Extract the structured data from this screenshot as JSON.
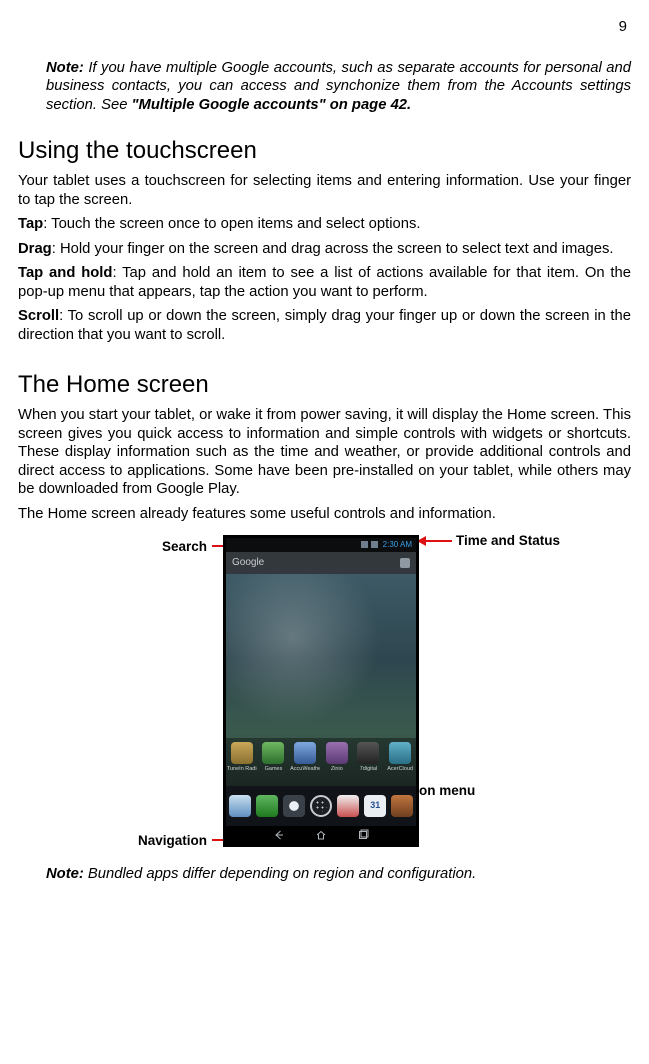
{
  "page_number": "9",
  "top_note": {
    "label": "Note:",
    "text_a": " If you have multiple Google accounts, such as separate accounts for personal and business contacts, you can access and synchonize them from the Accounts settings section. See ",
    "emph": "\"Multiple Google accounts\" on page 42.",
    "text_b": ""
  },
  "section1": {
    "heading": "Using the touchscreen",
    "intro": "Your tablet uses a touchscreen for selecting items and entering information. Use your finger to tap the screen.",
    "defs": [
      {
        "term": "Tap",
        "text": ": Touch the screen once to open items and select options."
      },
      {
        "term": "Drag",
        "text": ": Hold your finger on the screen and drag across the screen to select text and images."
      },
      {
        "term": "Tap and hold",
        "text": ": Tap and hold an item to see a list of actions available for that item. On the pop-up menu that appears, tap the action you want to perform."
      },
      {
        "term": "Scroll",
        "text": ": To scroll up or down the screen, simply drag your finger up or down the screen in the direction that you want to scroll."
      }
    ]
  },
  "section2": {
    "heading": "The Home screen",
    "p1": "When you start your tablet, or wake it from power saving, it will display the Home screen. This screen gives you quick access to information and simple controls with widgets or shortcuts. These display information such as the time and weather, or provide additional controls and direct access to applications. Some have been pre-installed on your tablet, while others may be downloaded from Google Play.",
    "p2": "The Home screen already features some useful controls and information."
  },
  "figure": {
    "labels": {
      "search": "Search",
      "time_status": "Time and Status",
      "app_menu": "Application menu",
      "navigation": "Navigation"
    },
    "screenshot": {
      "status_time": "2:30 AM",
      "search_placeholder": "Google",
      "app_row": [
        "TuneIn Radio",
        "Games",
        "AccuWeather",
        "Zinio",
        "7digital",
        "AcerCloud"
      ]
    }
  },
  "bottom_note": {
    "label": "Note:",
    "text": " Bundled apps differ depending on region and configuration."
  }
}
